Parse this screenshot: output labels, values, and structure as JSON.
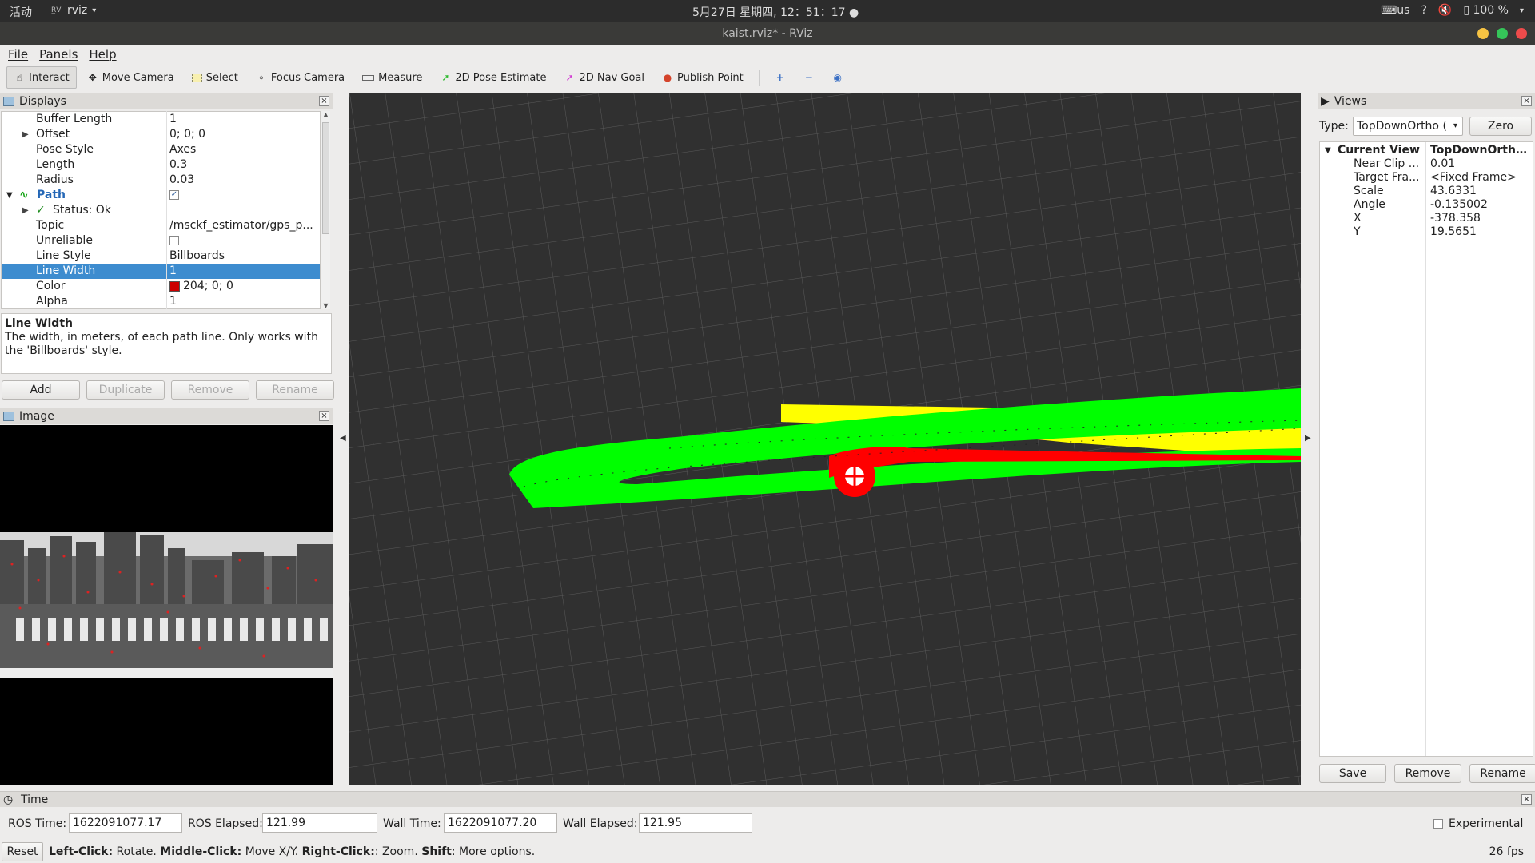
{
  "system": {
    "activities": "活动",
    "app_name": "rviz",
    "clock": "5月27日 星期四, 12：51：17",
    "keyboard": "us",
    "battery": "100 %"
  },
  "window": {
    "title": "kaist.rviz* - RViz"
  },
  "menu": {
    "file": "File",
    "panels": "Panels",
    "help": "Help"
  },
  "toolbar": {
    "interact": "Interact",
    "move_camera": "Move Camera",
    "select": "Select",
    "focus_camera": "Focus Camera",
    "measure": "Measure",
    "pose_estimate": "2D Pose Estimate",
    "nav_goal": "2D Nav Goal",
    "publish_point": "Publish Point"
  },
  "displays": {
    "title": "Displays",
    "rows": [
      {
        "key": "Buffer Length",
        "value": "1"
      },
      {
        "key": "Offset",
        "value": "0; 0; 0"
      },
      {
        "key": "Pose Style",
        "value": "Axes"
      },
      {
        "key": "Length",
        "value": "0.3"
      },
      {
        "key": "Radius",
        "value": "0.03"
      },
      {
        "key": "Path",
        "value": "✓"
      },
      {
        "key": "Status: Ok",
        "value": ""
      },
      {
        "key": "Topic",
        "value": "/msckf_estimator/gps_p..."
      },
      {
        "key": "Unreliable",
        "value": ""
      },
      {
        "key": "Line Style",
        "value": "Billboards"
      },
      {
        "key": "Line Width",
        "value": "1"
      },
      {
        "key": "Color",
        "value": "204; 0; 0"
      },
      {
        "key": "Alpha",
        "value": "1"
      }
    ],
    "desc_title": "Line Width",
    "desc_text": "The width, in meters, of each path line. Only works with the 'Billboards' style.",
    "buttons": {
      "add": "Add",
      "duplicate": "Duplicate",
      "remove": "Remove",
      "rename": "Rename"
    }
  },
  "image_panel": {
    "title": "Image"
  },
  "views": {
    "title": "Views",
    "type_label": "Type:",
    "type_value": "TopDownOrtho (",
    "zero": "Zero",
    "rows": [
      {
        "key": "Current View",
        "value": "TopDownOrtho ..."
      },
      {
        "key": "Near Clip ...",
        "value": "0.01"
      },
      {
        "key": "Target Fra...",
        "value": "<Fixed Frame>"
      },
      {
        "key": "Scale",
        "value": "43.6331"
      },
      {
        "key": "Angle",
        "value": "-0.135002"
      },
      {
        "key": "X",
        "value": "-378.358"
      },
      {
        "key": "Y",
        "value": "19.5651"
      }
    ],
    "buttons": {
      "save": "Save",
      "remove": "Remove",
      "rename": "Rename"
    }
  },
  "time": {
    "title": "Time",
    "ros_time_label": "ROS Time:",
    "ros_time": "1622091077.17",
    "ros_elapsed_label": "ROS Elapsed:",
    "ros_elapsed": "121.99",
    "wall_time_label": "Wall Time:",
    "wall_time": "1622091077.20",
    "wall_elapsed_label": "Wall Elapsed:",
    "wall_elapsed": "121.95",
    "experimental": "Experimental"
  },
  "status": {
    "reset": "Reset",
    "left_click": "Left-Click:",
    "left_click_desc": "Rotate.",
    "middle_click": "Middle-Click:",
    "middle_click_desc": "Move X/Y.",
    "right_click": "Right-Click:",
    "right_click_desc": ": Zoom.",
    "shift": "Shift",
    "shift_desc": ": More options.",
    "fps": "26 fps"
  },
  "colors": {
    "path_color": "#cc0000",
    "accent": "#3d8ccf"
  }
}
